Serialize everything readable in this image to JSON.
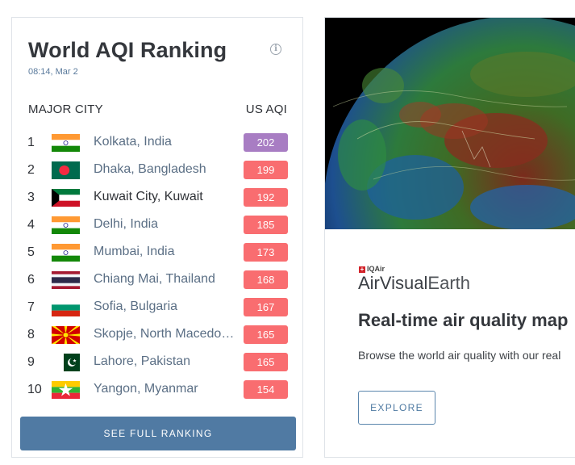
{
  "ranking": {
    "title": "World AQI Ranking",
    "timestamp": "08:14, Mar 2",
    "info_icon": "info-circle-icon",
    "column_city": "MAJOR CITY",
    "column_aqi": "US AQI",
    "cta_label": "SEE FULL RANKING",
    "colors": {
      "unhealthy": "#f96d70",
      "very_unhealthy": "#a87dc3",
      "button": "#507aa3"
    },
    "items": [
      {
        "rank": "1",
        "city": "Kolkata, India",
        "aqi": "202",
        "flag": "india-flag-icon",
        "level": "very-unhealthy"
      },
      {
        "rank": "2",
        "city": "Dhaka, Bangladesh",
        "aqi": "199",
        "flag": "bangladesh-flag-icon",
        "level": "unhealthy"
      },
      {
        "rank": "3",
        "city": "Kuwait City, Kuwait",
        "aqi": "192",
        "flag": "kuwait-flag-icon",
        "level": "unhealthy"
      },
      {
        "rank": "4",
        "city": "Delhi, India",
        "aqi": "185",
        "flag": "india-flag-icon",
        "level": "unhealthy"
      },
      {
        "rank": "5",
        "city": "Mumbai, India",
        "aqi": "173",
        "flag": "india-flag-icon",
        "level": "unhealthy"
      },
      {
        "rank": "6",
        "city": "Chiang Mai, Thailand",
        "aqi": "168",
        "flag": "thailand-flag-icon",
        "level": "unhealthy"
      },
      {
        "rank": "7",
        "city": "Sofia, Bulgaria",
        "aqi": "167",
        "flag": "bulgaria-flag-icon",
        "level": "unhealthy"
      },
      {
        "rank": "8",
        "city": "Skopje, North Macedonia",
        "aqi": "165",
        "flag": "north-macedonia-flag-icon",
        "level": "unhealthy"
      },
      {
        "rank": "9",
        "city": "Lahore, Pakistan",
        "aqi": "165",
        "flag": "pakistan-flag-icon",
        "level": "unhealthy"
      },
      {
        "rank": "10",
        "city": "Yangon, Myanmar",
        "aqi": "154",
        "flag": "myanmar-flag-icon",
        "level": "unhealthy"
      }
    ]
  },
  "promo": {
    "image": "earth-air-quality-globe-image",
    "brand_small": "IQAir",
    "brand_bold": "AirVisual",
    "brand_light": "Earth",
    "heading": "Real-time air quality map",
    "text": "Browse the world air quality with our real",
    "button_label": "EXPLORE"
  }
}
